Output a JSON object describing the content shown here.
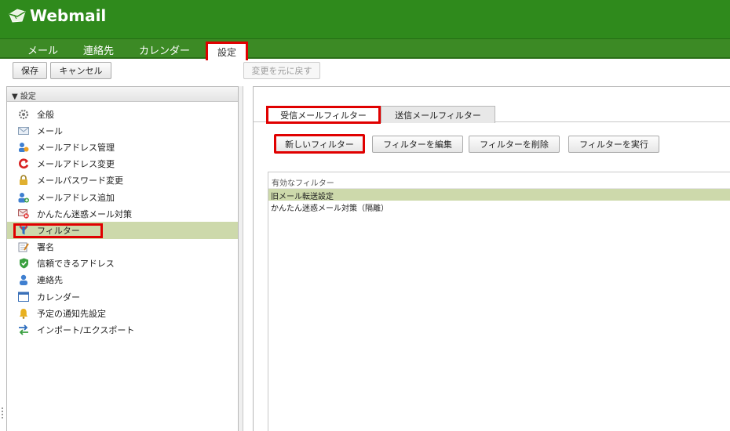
{
  "app": {
    "title": "Webmail"
  },
  "nav": {
    "items": [
      {
        "label": "メール"
      },
      {
        "label": "連絡先"
      },
      {
        "label": "カレンダー"
      }
    ],
    "active_label": "設定"
  },
  "toolbar": {
    "save_label": "保存",
    "cancel_label": "キャンセル",
    "revert_label": "変更を元に戻す"
  },
  "sidebar": {
    "header": "▼ 設定",
    "items": [
      {
        "label": "全般",
        "icon": "gear-icon"
      },
      {
        "label": "メール",
        "icon": "envelope-icon"
      },
      {
        "label": "メールアドレス管理",
        "icon": "address-admin-icon"
      },
      {
        "label": "メールアドレス変更",
        "icon": "refresh-icon"
      },
      {
        "label": "メールパスワード変更",
        "icon": "lock-icon"
      },
      {
        "label": "メールアドレス追加",
        "icon": "add-user-icon"
      },
      {
        "label": "かんたん迷惑メール対策",
        "icon": "spam-icon"
      },
      {
        "label": "フィルター",
        "icon": "filter-icon",
        "selected": true
      },
      {
        "label": "署名",
        "icon": "signature-icon"
      },
      {
        "label": "信頼できるアドレス",
        "icon": "shield-icon"
      },
      {
        "label": "連絡先",
        "icon": "contact-icon"
      },
      {
        "label": "カレンダー",
        "icon": "calendar-icon"
      },
      {
        "label": "予定の通知先設定",
        "icon": "bell-icon"
      },
      {
        "label": "インポート/エクスポート",
        "icon": "import-export-icon"
      }
    ]
  },
  "main": {
    "tabs": [
      {
        "label": "受信メールフィルター",
        "active": true
      },
      {
        "label": "送信メールフィルター",
        "active": false
      }
    ],
    "buttons": {
      "new_filter": "新しいフィルター",
      "edit_filter": "フィルターを編集",
      "delete_filter": "フィルターを削除",
      "run_filter": "フィルターを実行"
    },
    "filter_list": {
      "header": "有効なフィルター",
      "rows": [
        {
          "label": "旧メール転送設定",
          "selected": true
        },
        {
          "label": "かんたん迷惑メール対策（隔離）",
          "selected": false
        }
      ]
    }
  },
  "colors": {
    "header_green": "#2f8a1c",
    "selection_green": "#cdd9ab",
    "highlight_red": "#e00000"
  }
}
